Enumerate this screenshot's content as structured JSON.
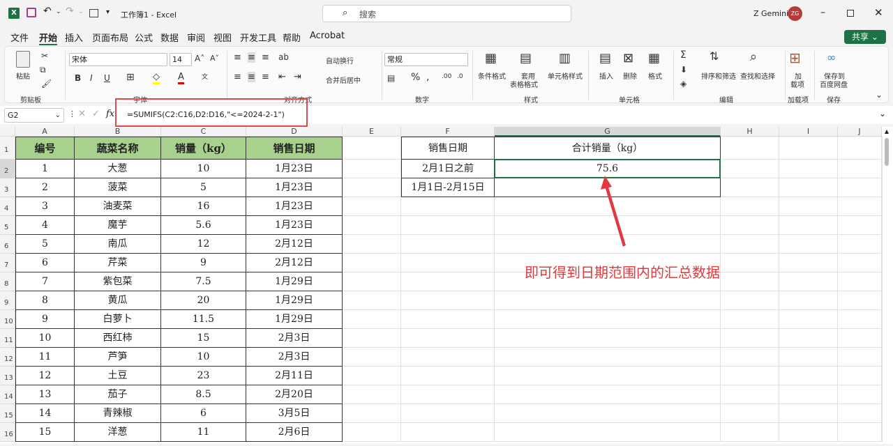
{
  "titlebar": {
    "title": "工作簿1 - Excel",
    "search_placeholder": "搜索",
    "user": "Z Gemini",
    "avatar": "ZG"
  },
  "menu": [
    "文件",
    "开始",
    "插入",
    "页面布局",
    "公式",
    "数据",
    "审阅",
    "视图",
    "开发工具",
    "帮助",
    "Acrobat"
  ],
  "share_label": "共享",
  "ribbon": {
    "paste": "粘贴",
    "font_name": "宋体",
    "font_size": "14",
    "wrap": "自动换行",
    "merge": "合并后居中",
    "number_format": "常规",
    "cond_format": "条件格式",
    "table_format_1": "套用",
    "table_format_2": "表格格式",
    "cell_style": "单元格样式",
    "insert": "插入",
    "delete": "删除",
    "format": "格式",
    "sort_filter": "排序和筛选",
    "find_select": "查找和选择",
    "addin_1": "加",
    "addin_2": "载项",
    "save_1": "保存到",
    "save_2": "百度网盘",
    "groups": [
      "剪贴板",
      "字体",
      "对齐方式",
      "数字",
      "样式",
      "单元格",
      "编辑",
      "加载项",
      "保存"
    ]
  },
  "formula": {
    "namebox": "G2",
    "fx": "fx",
    "text": "=SUMIFS(C2:C16,D2:D16,\"<=2024-2-1\")"
  },
  "columns": [
    "A",
    "B",
    "C",
    "D",
    "E",
    "F",
    "G",
    "H",
    "I",
    "J"
  ],
  "rows": [
    "1",
    "2",
    "3",
    "4",
    "5",
    "6",
    "7",
    "8",
    "9",
    "10",
    "11",
    "12",
    "13",
    "14",
    "15",
    "16"
  ],
  "table_headers": [
    "编号",
    "蔬菜名称",
    "销量（kg）",
    "销售日期"
  ],
  "table_rows": [
    [
      "1",
      "大葱",
      "10",
      "1月23日"
    ],
    [
      "2",
      "菠菜",
      "5",
      "1月23日"
    ],
    [
      "3",
      "油麦菜",
      "16",
      "1月23日"
    ],
    [
      "4",
      "魔芋",
      "5.6",
      "1月23日"
    ],
    [
      "5",
      "南瓜",
      "12",
      "2月12日"
    ],
    [
      "6",
      "芹菜",
      "9",
      "2月12日"
    ],
    [
      "7",
      "紫包菜",
      "7.5",
      "1月29日"
    ],
    [
      "8",
      "黄瓜",
      "20",
      "1月29日"
    ],
    [
      "9",
      "白萝卜",
      "11.5",
      "1月29日"
    ],
    [
      "10",
      "西红柿",
      "15",
      "2月3日"
    ],
    [
      "11",
      "芦笋",
      "10",
      "2月3日"
    ],
    [
      "12",
      "土豆",
      "23",
      "2月11日"
    ],
    [
      "13",
      "茄子",
      "8.5",
      "2月20日"
    ],
    [
      "14",
      "青辣椒",
      "6",
      "3月5日"
    ],
    [
      "15",
      "洋葱",
      "11",
      "2月6日"
    ]
  ],
  "summary": {
    "header_f": "销售日期",
    "header_g": "合计销量（kg）",
    "row1_f": "2月1日之前",
    "row1_g": "75.6",
    "row2_f": "1月1日-2月15日",
    "row2_g": ""
  },
  "annotation": "即可得到日期范围内的汇总数据",
  "colors": {
    "header_green": "#a9d18e",
    "excel_green": "#1e7145",
    "annotation_red": "#e0393e"
  }
}
